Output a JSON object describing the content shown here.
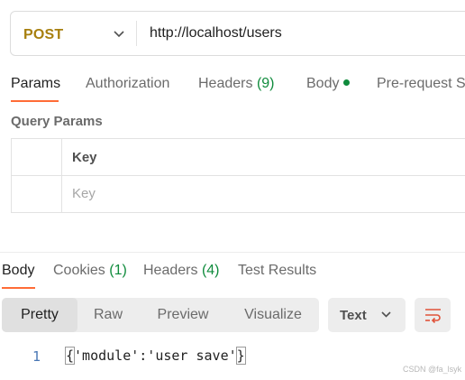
{
  "request": {
    "method": "POST",
    "url": "http://localhost/users",
    "method_color": "#a77f0e"
  },
  "request_tabs": [
    {
      "label": "Params",
      "active": true
    },
    {
      "label": "Authorization"
    },
    {
      "label": "Headers",
      "count": "(9)"
    },
    {
      "label": "Body",
      "has_dot": true
    },
    {
      "label": "Pre-request S"
    }
  ],
  "query_params": {
    "title": "Query Params",
    "header_key": "Key",
    "key_placeholder": "Key"
  },
  "response_tabs": [
    {
      "label": "Body",
      "active": true
    },
    {
      "label": "Cookies",
      "count": "(1)"
    },
    {
      "label": "Headers",
      "count": "(4)"
    },
    {
      "label": "Test Results"
    }
  ],
  "view_modes": [
    "Pretty",
    "Raw",
    "Preview",
    "Visualize"
  ],
  "active_view_mode": "Pretty",
  "format": "Text",
  "wrap_icon": "wrap-lines-icon",
  "code": {
    "line_number": "1",
    "open_brace": "{",
    "content": "'module':'user save'",
    "close_brace": "}"
  },
  "watermark": "CSDN @fa_lsyk",
  "colors": {
    "accent": "#ff6c37",
    "count_green": "#0f8b3c"
  }
}
